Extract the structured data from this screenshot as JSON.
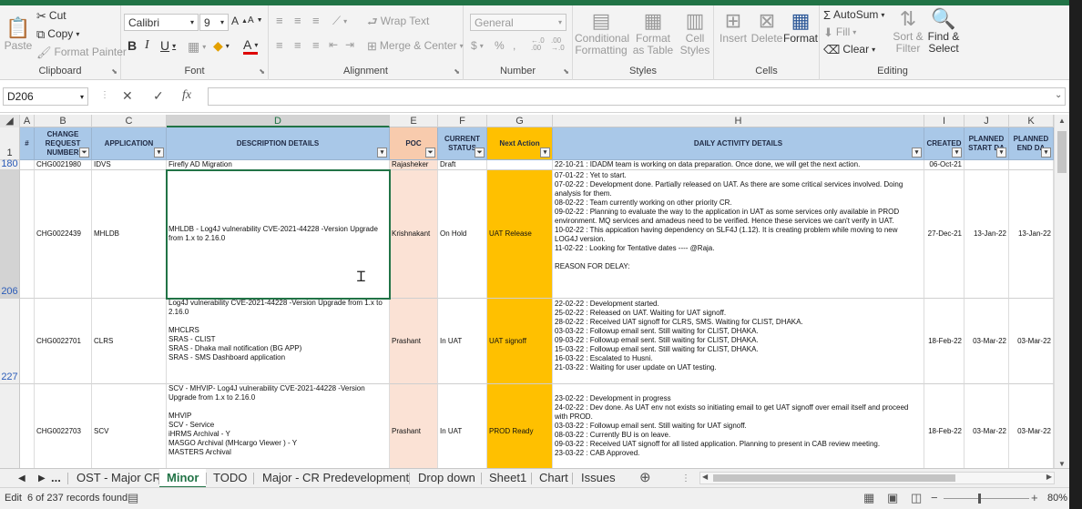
{
  "ribbon": {
    "clipboard": {
      "paste": "Paste",
      "cut": "Cut",
      "copy": "Copy",
      "format_painter": "Format Painter",
      "label": "Clipboard"
    },
    "font": {
      "name": "Calibri",
      "size": "9",
      "label": "Font"
    },
    "alignment": {
      "wrap": "Wrap Text",
      "merge": "Merge & Center",
      "label": "Alignment"
    },
    "number": {
      "format": "General",
      "label": "Number"
    },
    "styles": {
      "conditional": "Conditional Formatting",
      "format_table": "Format as Table",
      "cell_styles": "Cell Styles",
      "label": "Styles"
    },
    "cells": {
      "insert": "Insert",
      "delete": "Delete",
      "format": "Format",
      "label": "Cells"
    },
    "editing": {
      "autosum": "AutoSum",
      "fill": "Fill",
      "clear": "Clear",
      "sort": "Sort & Filter",
      "find": "Find & Select",
      "label": "Editing"
    }
  },
  "formula_bar": {
    "name_box": "D206",
    "value": ""
  },
  "columns": [
    "A",
    "B",
    "C",
    "D",
    "E",
    "F",
    "G",
    "H",
    "I",
    "J",
    "K"
  ],
  "header_row": {
    "row_num": "1",
    "a": "#",
    "b": "CHANGE REQUEST NUMBER",
    "c": "APPLICATION",
    "d": "DESCRIPTION DETAILS",
    "e": "POC",
    "f": "CURRENT STATUS",
    "g": "Next Action",
    "h": "DAILY ACTIVITY DETAILS",
    "i": "CREATED",
    "j": "PLANNED START DA",
    "k": "PLANNED END DA"
  },
  "rows": [
    {
      "num": "180",
      "cr": "CHG0021980",
      "app": "IDVS",
      "desc": "Firefly AD Migration",
      "poc": "Rajasheker",
      "status": "Draft",
      "next": "",
      "daily": "22-10-21 : IDADM team is working on data preparation. Once done, we will get the next action.",
      "created": "06-Oct-21",
      "start": "",
      "end": ""
    },
    {
      "num": "206",
      "cr": "CHG0022439",
      "app": "MHLDB",
      "desc": "MHLDB - Log4J vulnerability CVE-2021-44228 -Version Upgrade from 1.x to 2.16.0",
      "poc": "Krishnakant",
      "status": "On Hold",
      "next": "UAT Release",
      "daily": "07-01-22 : Yet to start.\n07-02-22 : Development done. Partially released on UAT. As there are some critical services involved. Doing analysis for them.\n08-02-22 : Team currently working on other priority CR.\n09-02-22 : Planning to evaluate the way to the application in UAT as some services only available in PROD environment. MQ services and amadeus need to be verified. Hence these services we can't verify in UAT.\n10-02-22 : This appication having dependency on SLF4J (1.12). It is creating problem while moving to new LOG4J version.\n11-02-22 : Looking for Tentative dates ---- @Raja.\n\nREASON FOR DELAY:",
      "created": "27-Dec-21",
      "start": "13-Jan-22",
      "end": "13-Jan-22"
    },
    {
      "num": "227",
      "cr": "CHG0022701",
      "app": "CLRS",
      "desc": "Log4J vulnerability CVE-2021-44228 -Version Upgrade from 1.x to 2.16.0\n\nMHCLRS\nSRAS - CLIST\nSRAS - Dhaka mail notification (BG APP)\nSRAS - SMS Dashboard application",
      "poc": "Prashant",
      "status": "In UAT",
      "next": "UAT signoff",
      "daily": "22-02-22 : Development started.\n25-02-22 : Released on UAT. Waiting for UAT signoff.\n28-02-22 : Received UAT signoff for CLRS, SMS. Waiting for CLIST, DHAKA.\n03-03-22 : Followup email sent. Still waiting for CLIST, DHAKA.\n09-03-22 : Followup email sent. Still waiting for CLIST, DHAKA.\n15-03-22 : Followup email sent. Still waiting for CLIST, DHAKA.\n16-03-22 : Escalated to Husni.\n21-03-22 : Waiting for user update on UAT testing.",
      "created": "18-Feb-22",
      "start": "03-Mar-22",
      "end": "03-Mar-22"
    },
    {
      "num": "",
      "cr": "CHG0022703",
      "app": "SCV",
      "desc": "SCV - MHVIP- Log4J vulnerability CVE-2021-44228 -Version Upgrade from 1.x to 2.16.0\n\nMHVIP\nSCV - Service\niHRMS Archival - Y\nMASGO Archival (MHcargo Viewer ) - Y\nMASTERS Archival",
      "poc": "Prashant",
      "status": "In UAT",
      "next": "PROD Ready",
      "daily": "\n23-02-22 : Development in progress\n24-02-22 : Dev done. As UAT env not exists so initiating email to get UAT signoff over email itself and proceed with PROD.\n03-03-22 : Followup email sent. Still waiting for UAT signoff.\n08-03-22 : Currently BU is on leave.\n09-03-22 : Received UAT signoff for all listed application. Planning to present in CAB review meeting.\n23-03-22 : CAB Approved.",
      "created": "18-Feb-22",
      "start": "03-Mar-22",
      "end": "03-Mar-22"
    }
  ],
  "tabs": [
    "...",
    "OST - Major CR",
    "Minor",
    "TODO",
    "Major - CR Predevelopment",
    "Drop down",
    "Sheet1",
    "Chart",
    "Issues"
  ],
  "active_tab": "Minor",
  "status": {
    "mode": "Edit",
    "records": "6 of 237 records found",
    "zoom": "80%"
  },
  "colors": {
    "header_blue": "#a9c8e8",
    "poc_fill": "#fbe2d5",
    "next_action": "#ffc000",
    "excel_green": "#217346"
  }
}
